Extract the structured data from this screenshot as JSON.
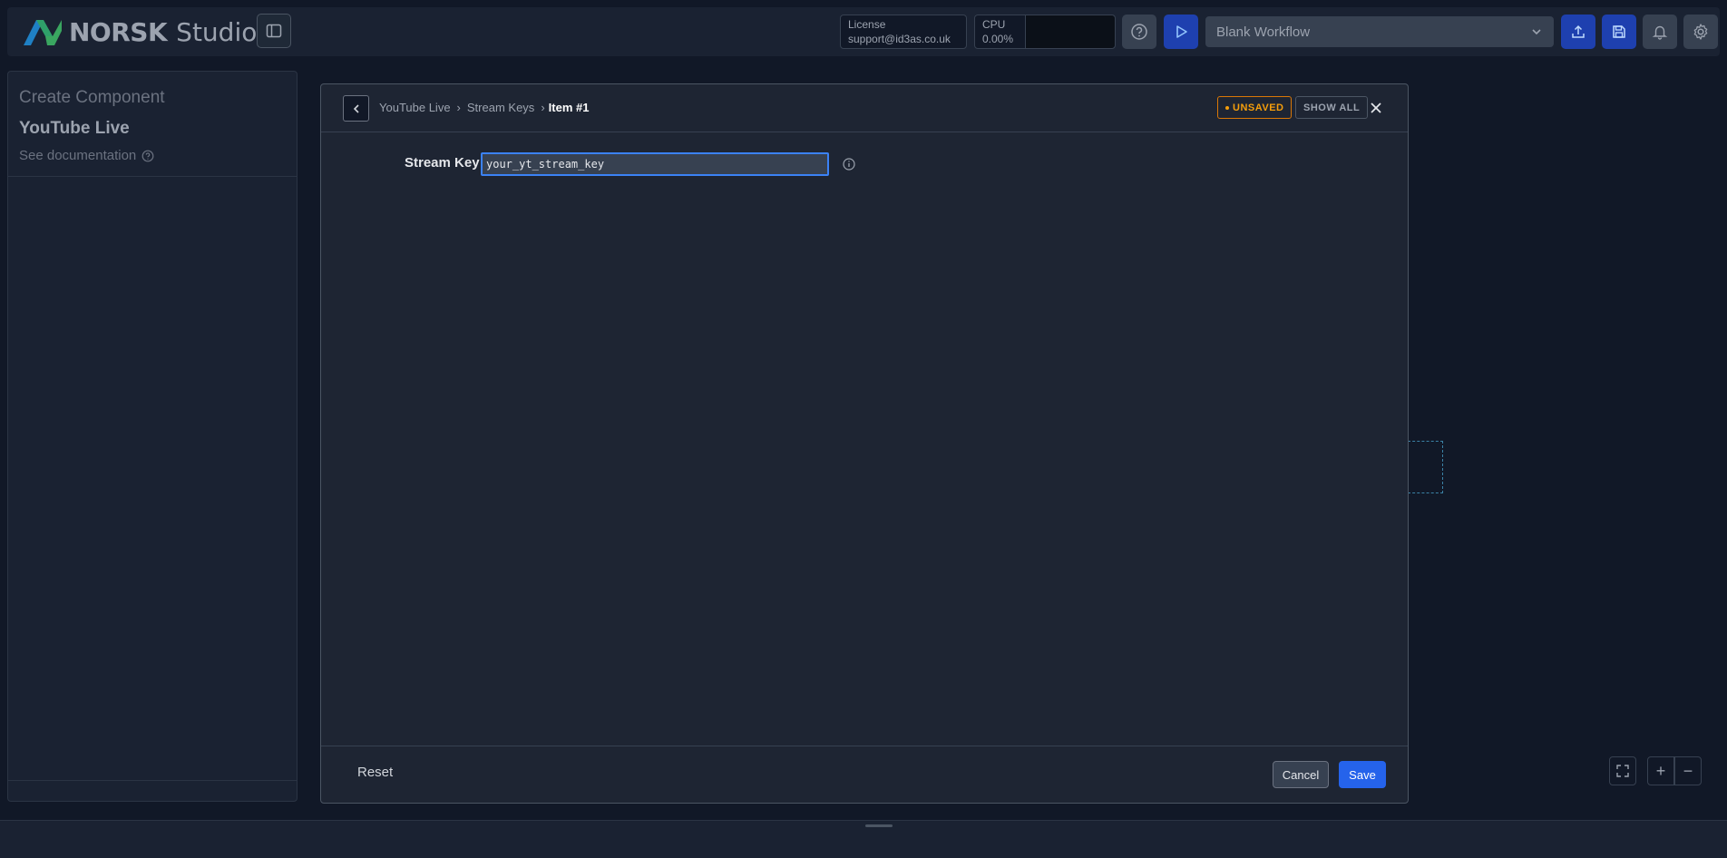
{
  "header": {
    "logo_brand": "NORSK",
    "logo_product": "Studio",
    "license_label": "License",
    "license_value": "support@id3as.co.uk",
    "cpu_label": "CPU",
    "cpu_value": "0.00%",
    "workflow_selected": "Blank Workflow"
  },
  "left_panel": {
    "subtitle": "Create Component",
    "title": "YouTube Live",
    "doc_link": "See documentation"
  },
  "modal": {
    "breadcrumb": [
      "YouTube Live",
      "Stream Keys",
      "Item #1"
    ],
    "badge_unsaved": "UNSAVED",
    "show_all_label": "SHOW ALL",
    "field_label": "Stream Key",
    "field_value": "your_yt_stream_key",
    "reset_label": "Reset",
    "cancel_label": "Cancel",
    "save_label": "Save"
  },
  "canvas": {
    "zoom_in": "+",
    "zoom_out": "−"
  },
  "colors": {
    "accent": "#2563eb",
    "warning": "#f59e0b",
    "logo_blue": "#1f80c4",
    "logo_green": "#3aa660"
  },
  "icons": [
    "sidebar-toggle-icon",
    "help-icon",
    "play-icon",
    "chevron-down-icon",
    "upload-icon",
    "save-icon",
    "bell-icon",
    "gear-icon",
    "chevron-left-icon",
    "close-icon",
    "info-icon",
    "help-circle-icon",
    "fullscreen-icon"
  ]
}
